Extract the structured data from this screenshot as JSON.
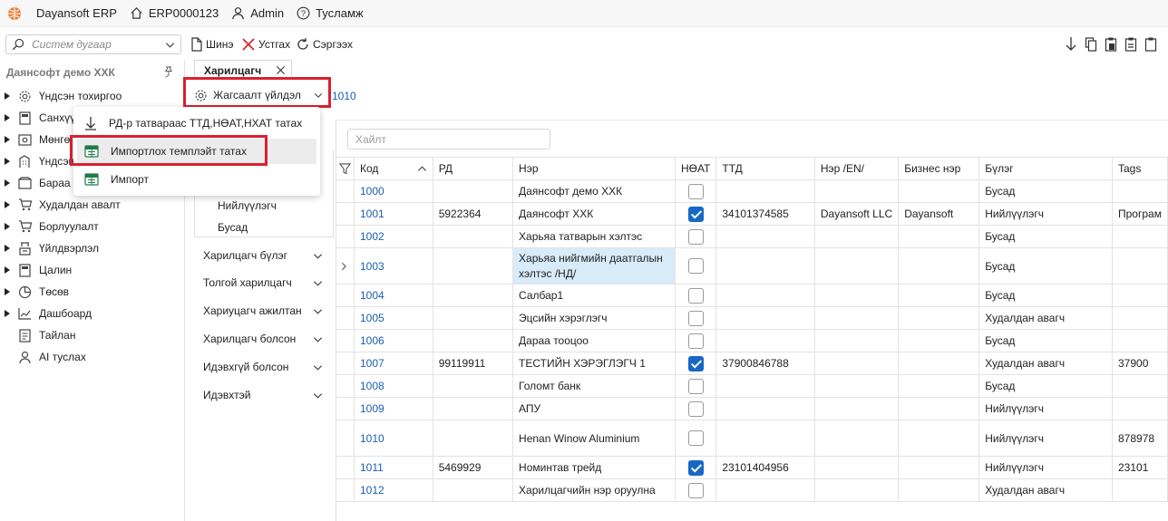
{
  "app": {
    "name": "Dayansoft ERP",
    "company_code": "ERP0000123",
    "user": "Admin",
    "help": "Тусламж"
  },
  "toolbar": {
    "search_placeholder": "Систем дугаар",
    "new_label": "Шинэ",
    "delete_label": "Устгах",
    "refresh_label": "Сэргээх"
  },
  "sidebar": {
    "title": "Даянсофт демо ХХК",
    "items": [
      {
        "label": "Үндсэн тохиргоо",
        "icon": "gear-icon"
      },
      {
        "label": "Санхүү",
        "icon": "calculator-icon"
      },
      {
        "label": "Мөнгө",
        "icon": "cash-icon"
      },
      {
        "label": "Үндсэн",
        "icon": "building-icon"
      },
      {
        "label": "Бараа",
        "icon": "box-icon"
      },
      {
        "label": "Худалдан авалт",
        "icon": "cart-icon"
      },
      {
        "label": "Борлуулалт",
        "icon": "cart-icon"
      },
      {
        "label": "Үйлдвэрлэл",
        "icon": "factory-icon"
      },
      {
        "label": "Цалин",
        "icon": "calculator-icon"
      },
      {
        "label": "Төсөв",
        "icon": "pie-chart-icon"
      },
      {
        "label": "Дашбоард",
        "icon": "chart-icon"
      },
      {
        "label": "Тайлан",
        "icon": "report-icon"
      },
      {
        "label": "AI туслах",
        "icon": "assistant-icon"
      }
    ]
  },
  "tab": {
    "label": "Харилцагч"
  },
  "settings_button": {
    "label": "Жагсаалт үйлдэл"
  },
  "partial_link": "1010",
  "menu": {
    "items": [
      {
        "label": "РД-р татвараас ТТД,НӨАТ,НХАТ татах",
        "icon": "download-icon"
      },
      {
        "label": "Импортлох темплэйт татах",
        "icon": "excel-icon"
      },
      {
        "label": "Импорт",
        "icon": "excel-icon"
      }
    ]
  },
  "filter_panel": {
    "items": [
      "Нийлүүлэгч",
      "Бусад"
    ],
    "groups": [
      "Харилцагч бүлэг",
      "Толгой харилцагч",
      "Хариуцагч ажилтан",
      "Харилцагч болсон",
      "Идэвхгүй болсон",
      "Идэвхтэй"
    ]
  },
  "grid": {
    "search_placeholder": "Хайлт",
    "columns": [
      "Код",
      "РД",
      "Нэр",
      "НӨАТ",
      "ТТД",
      "Нэр /EN/",
      "Бизнес нэр",
      "Бүлэг",
      "Tags"
    ],
    "rows": [
      {
        "code": "1000",
        "rd": "",
        "name": "Даянсофт демо ХХК",
        "vat": false,
        "ttd": "",
        "name_en": "",
        "biz": "",
        "group": "Бусад",
        "tags": ""
      },
      {
        "code": "1001",
        "rd": "5922364",
        "name": "Даянсофт ХХК",
        "vat": true,
        "ttd": "34101374585",
        "name_en": "Dayansoft LLC",
        "biz": "Dayansoft",
        "group": "Нийлүүлэгч",
        "tags": "Програм"
      },
      {
        "code": "1002",
        "rd": "",
        "name": "Харьяа татварын хэлтэс",
        "vat": false,
        "ttd": "",
        "name_en": "",
        "biz": "",
        "group": "Бусад",
        "tags": ""
      },
      {
        "code": "1003",
        "rd": "",
        "name": "Харьяа нийгмийн даатгалын хэлтэс /НД/",
        "vat": false,
        "ttd": "",
        "name_en": "",
        "biz": "",
        "group": "Бусад",
        "tags": ""
      },
      {
        "code": "1004",
        "rd": "",
        "name": "Салбар1",
        "vat": false,
        "ttd": "",
        "name_en": "",
        "biz": "",
        "group": "Бусад",
        "tags": ""
      },
      {
        "code": "1005",
        "rd": "",
        "name": "Эцсийн хэрэглэгч",
        "vat": false,
        "ttd": "",
        "name_en": "",
        "biz": "",
        "group": "Худалдан авагч",
        "tags": ""
      },
      {
        "code": "1006",
        "rd": "",
        "name": "Дараа тооцоо",
        "vat": false,
        "ttd": "",
        "name_en": "",
        "biz": "",
        "group": "Бусад",
        "tags": ""
      },
      {
        "code": "1007",
        "rd": "99119911",
        "name": "ТЕСТИЙН ХЭРЭГЛЭГЧ 1",
        "vat": true,
        "ttd": "37900846788",
        "name_en": "",
        "biz": "",
        "group": "Худалдан авагч",
        "tags": "37900"
      },
      {
        "code": "1008",
        "rd": "",
        "name": "Голомт банк",
        "vat": false,
        "ttd": "",
        "name_en": "",
        "biz": "",
        "group": "Бусад",
        "tags": ""
      },
      {
        "code": "1009",
        "rd": "",
        "name": "АПУ",
        "vat": false,
        "ttd": "",
        "name_en": "",
        "biz": "",
        "group": "Нийлүүлэгч",
        "tags": ""
      },
      {
        "code": "1010",
        "rd": "",
        "name": "Henan Winow Aluminium",
        "vat": false,
        "ttd": "",
        "name_en": "",
        "biz": "",
        "group": "Нийлүүлэгч",
        "tags": "878978"
      },
      {
        "code": "1011",
        "rd": "5469929",
        "name": "Номинтав трейд",
        "vat": true,
        "ttd": "23101404956",
        "name_en": "",
        "biz": "",
        "group": "Нийлүүлэгч",
        "tags": "23101"
      },
      {
        "code": "1012",
        "rd": "",
        "name": "Харилцагчийн нэр оруулна",
        "vat": false,
        "ttd": "",
        "name_en": "",
        "biz": "",
        "group": "Худалдан авагч",
        "tags": ""
      }
    ]
  },
  "colors": {
    "accent_blue": "#1a5fb4",
    "highlight_red": "#d9202e",
    "selected_cell": "#d8ebf9",
    "logo_orange": "#e8843c"
  }
}
